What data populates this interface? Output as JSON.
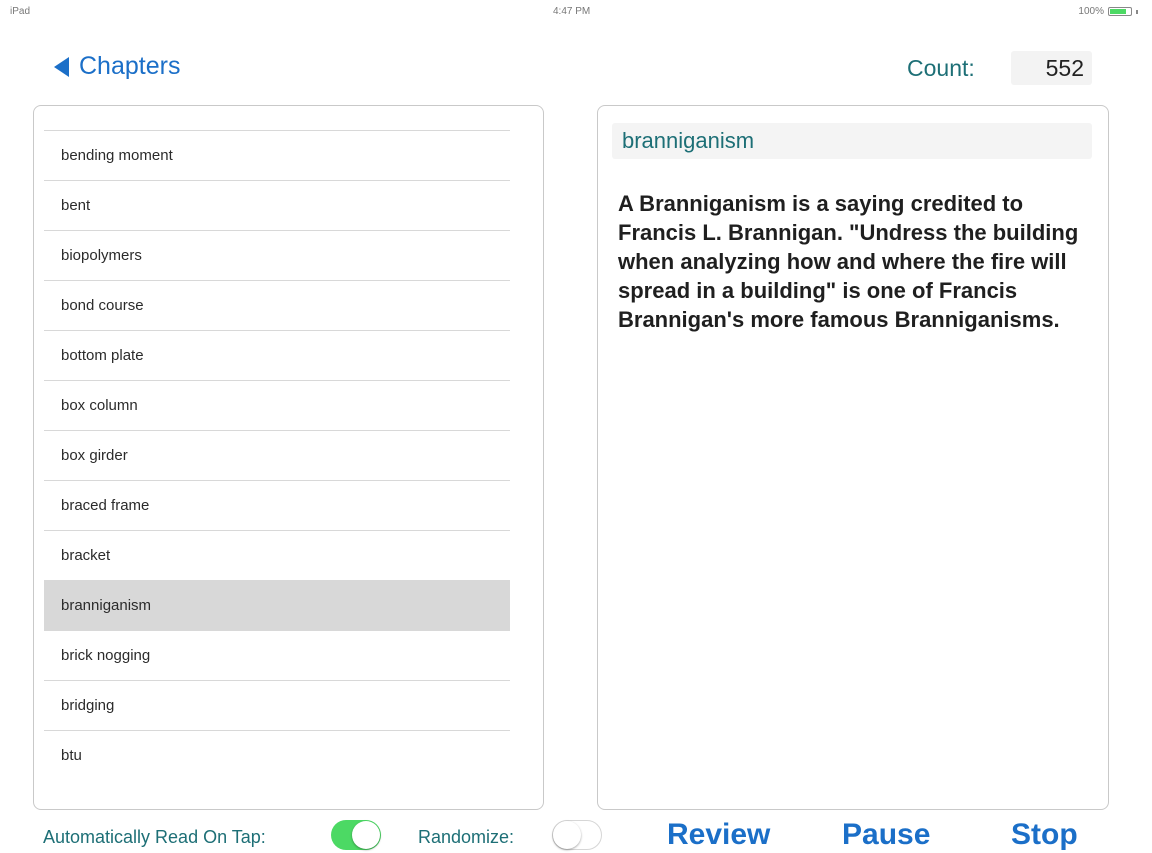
{
  "status_bar": {
    "device": "iPad",
    "time": "4:47 PM",
    "battery": "100%"
  },
  "nav": {
    "back_label": "Chapters"
  },
  "count": {
    "label": "Count:",
    "value": "552"
  },
  "term_list": {
    "items": [
      "bending moment",
      "bent",
      "biopolymers",
      "bond course",
      "bottom plate",
      "box column",
      "box girder",
      "braced frame",
      "bracket",
      "branniganism",
      "brick nogging",
      "bridging",
      "btu"
    ],
    "selected": "branniganism"
  },
  "detail": {
    "term": "branniganism",
    "definition": "A Branniganism is a saying credited to Francis L. Brannigan.  \"Undress the building when analyzing how and where the fire will spread in a building\" is one of Francis Brannigan's more famous Branniganisms."
  },
  "controls": {
    "auto_read_label": "Automatically Read On Tap:",
    "auto_read_on": true,
    "randomize_label": "Randomize:",
    "randomize_on": false,
    "review_label": "Review",
    "pause_label": "Pause",
    "stop_label": "Stop"
  },
  "colors": {
    "accent_blue": "#1b6fc8",
    "teal": "#1d6f76",
    "toggle_on": "#4cd964",
    "selected_row": "#d8d8d8"
  }
}
